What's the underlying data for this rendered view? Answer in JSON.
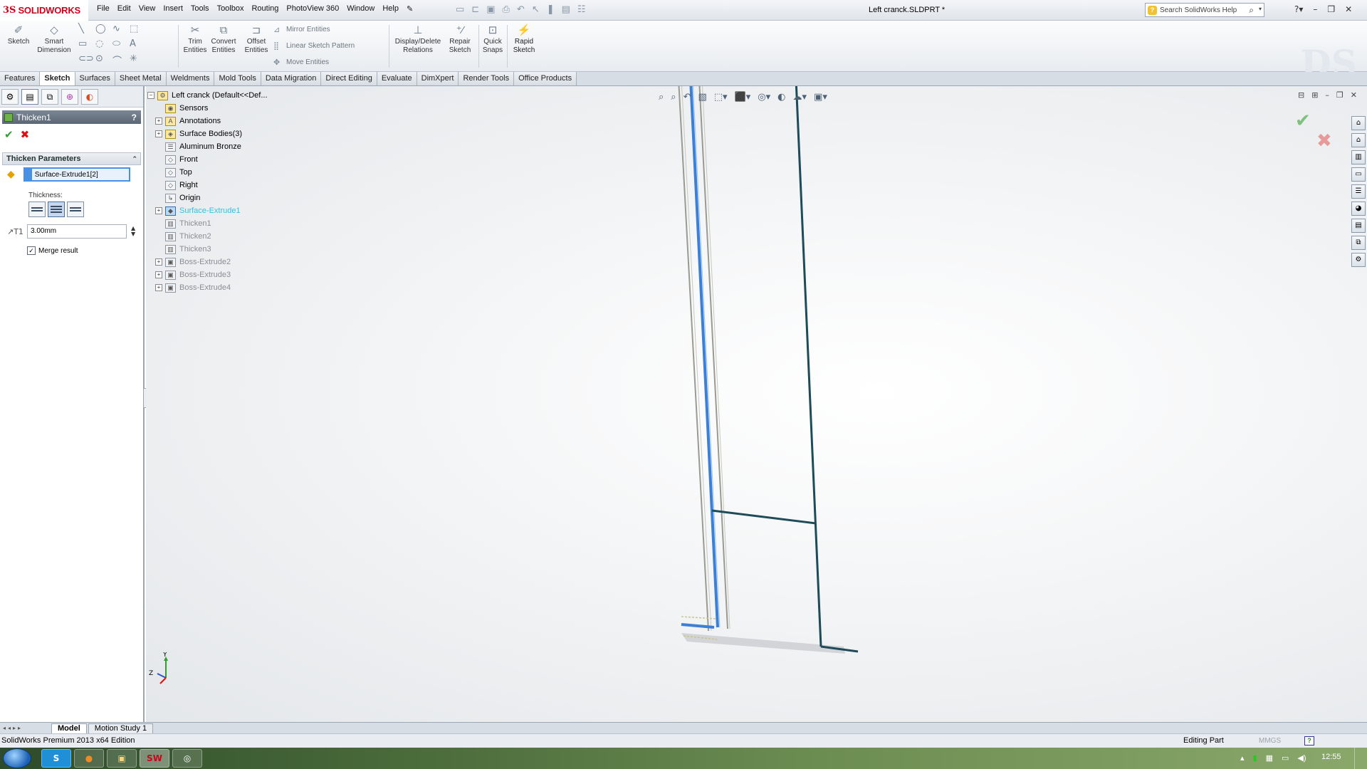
{
  "app": {
    "logo_ds": "3S",
    "logo_name": "SOLIDWORKS",
    "document_title": "Left cranck.SLDPRT *"
  },
  "menu": [
    "File",
    "Edit",
    "View",
    "Insert",
    "Tools",
    "Toolbox",
    "Routing",
    "PhotoView 360",
    "Window",
    "Help"
  ],
  "search": {
    "placeholder": "Search SolidWorks Help"
  },
  "ribbon": {
    "sketch": "Sketch",
    "smart_dimension_1": "Smart",
    "smart_dimension_2": "Dimension",
    "trim_1": "Trim",
    "trim_2": "Entities",
    "convert_1": "Convert",
    "convert_2": "Entities",
    "offset_1": "Offset",
    "offset_2": "Entities",
    "mirror": "Mirror Entities",
    "linear_pattern": "Linear Sketch Pattern",
    "move": "Move Entities",
    "display_relations_1": "Display/Delete",
    "display_relations_2": "Relations",
    "repair_1": "Repair",
    "repair_2": "Sketch",
    "quick_snaps_1": "Quick",
    "quick_snaps_2": "Snaps",
    "rapid_sketch_1": "Rapid",
    "rapid_sketch_2": "Sketch"
  },
  "tabs": [
    "Features",
    "Sketch",
    "Surfaces",
    "Sheet Metal",
    "Weldments",
    "Mold Tools",
    "Data Migration",
    "Direct Editing",
    "Evaluate",
    "DimXpert",
    "Render Tools",
    "Office Products"
  ],
  "active_tab": "Sketch",
  "property_manager": {
    "title": "Thicken1",
    "help": "?",
    "group_title": "Thicken Parameters",
    "selected_face": "Surface-Extrude1[2]",
    "thickness_label": "Thickness:",
    "thickness_value": "3.00mm",
    "merge_label": "Merge result",
    "merge_checked": true
  },
  "tree": {
    "root": "Left cranck  (Default<<Def...",
    "items": [
      {
        "label": "Sensors",
        "expandable": false,
        "state": "normal"
      },
      {
        "label": "Annotations",
        "expandable": true,
        "state": "normal"
      },
      {
        "label": "Surface Bodies(3)",
        "expandable": true,
        "state": "normal"
      },
      {
        "label": "Aluminum Bronze",
        "expandable": false,
        "state": "normal"
      },
      {
        "label": "Front",
        "expandable": false,
        "state": "normal"
      },
      {
        "label": "Top",
        "expandable": false,
        "state": "normal"
      },
      {
        "label": "Right",
        "expandable": false,
        "state": "normal"
      },
      {
        "label": "Origin",
        "expandable": false,
        "state": "normal"
      },
      {
        "label": "Surface-Extrude1",
        "expandable": true,
        "state": "selected"
      },
      {
        "label": "Thicken1",
        "expandable": false,
        "state": "suppressed"
      },
      {
        "label": "Thicken2",
        "expandable": false,
        "state": "suppressed"
      },
      {
        "label": "Thicken3",
        "expandable": false,
        "state": "suppressed"
      },
      {
        "label": "Boss-Extrude2",
        "expandable": true,
        "state": "suppressed"
      },
      {
        "label": "Boss-Extrude3",
        "expandable": true,
        "state": "suppressed"
      },
      {
        "label": "Boss-Extrude4",
        "expandable": true,
        "state": "suppressed"
      }
    ]
  },
  "triad": {
    "y": "Y",
    "z": "Z"
  },
  "bottom_tabs": [
    "Model",
    "Motion Study 1"
  ],
  "status": {
    "edition": "SolidWorks Premium 2013 x64 Edition",
    "mode": "Editing Part",
    "units": "MMGS",
    "help": "?"
  },
  "taskbar": {
    "apps": [
      "S",
      "",
      "",
      "",
      ""
    ],
    "clock": "12:55"
  },
  "colors": {
    "accent": "#4a90e2",
    "selected_tree_text": "#31c2e0",
    "ok": "#2f9e2f",
    "cancel": "#dd1111",
    "model_line": "#1d4b5a"
  }
}
